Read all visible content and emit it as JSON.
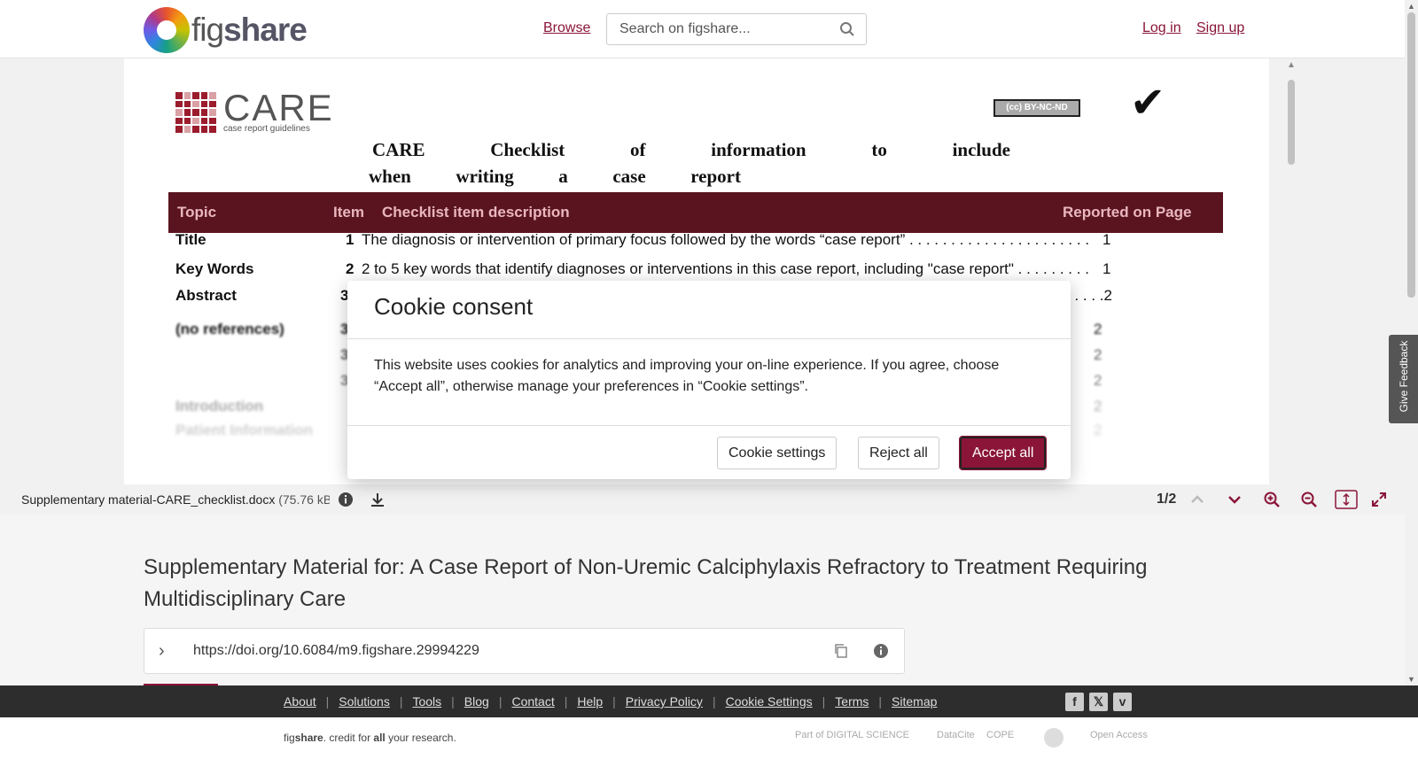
{
  "header": {
    "logo_text_light": "fig",
    "logo_text_bold": "share",
    "browse": "Browse",
    "search_placeholder": "Search on figshare...",
    "login": "Log in",
    "signup": "Sign up"
  },
  "document": {
    "care_title": "CARE",
    "care_subtitle": "case report guidelines",
    "license_badge": "BY-NC-ND",
    "heading_line1": [
      "CARE",
      "Checklist",
      "of",
      "information",
      "to",
      "include"
    ],
    "heading_line2": [
      "when",
      "writing",
      "a",
      "case",
      "report"
    ],
    "table_headers": [
      "Topic",
      "Item",
      "Checklist item description",
      "Reported on Page"
    ],
    "rows": [
      {
        "topic": "Title",
        "num": "1",
        "desc": "The diagnosis or intervention of primary focus followed by the words “case report” . . . . . . . . . . . . . . . . . . . . . .",
        "page": "1"
      },
      {
        "topic": "Key Words",
        "num": "2",
        "desc": "2 to 5 key words that identify diagnoses or interventions in this case report, including \"case report\"  . . . . . . . . .",
        "page": "1"
      },
      {
        "topic": "Abstract",
        "num": "3",
        "desc": "",
        "page": ". . . . .2"
      },
      {
        "topic": "(no references)",
        "num": "3",
        "desc": "",
        "page": "2"
      },
      {
        "topic": "",
        "num": "3",
        "desc": "",
        "page": "2"
      },
      {
        "topic": "",
        "num": "3",
        "desc": "",
        "page": "2"
      },
      {
        "topic": "Introduction",
        "num": "",
        "desc": "",
        "page": "2"
      },
      {
        "topic": "Patient Information",
        "num": "",
        "desc": "",
        "page": "2"
      }
    ]
  },
  "toolbar": {
    "filename": "Supplementary material-CARE_checklist.docx",
    "filesize": "(75.76 kB",
    "page_count": "1/2"
  },
  "item": {
    "title": "Supplementary Material for: A Case Report of Non-Uremic Calciphylaxis Refractory to Treatment Requiring Multidisciplinary Care",
    "doi": "https://doi.org/10.6084/m9.figshare.29994229"
  },
  "feedback": "Give Feedback",
  "footer": {
    "links": [
      "About",
      "Solutions",
      "Tools",
      "Blog",
      "Contact",
      "Help",
      "Privacy Policy",
      "Cookie Settings",
      "Terms",
      "Sitemap"
    ],
    "tagline_pre": "fig",
    "tagline_bold": "share",
    "tagline_mid": ". credit for ",
    "tagline_all": "all",
    "tagline_end": " your research.",
    "partners": [
      "Part of DIGITAL SCIENCE",
      "DataCite",
      "COPE",
      "Open Access"
    ]
  },
  "cookie_modal": {
    "title": "Cookie consent",
    "body": "This website uses cookies for analytics and improving your on-line experience. If you agree, choose “Accept all”, otherwise manage your preferences in “Cookie settings”.",
    "settings_label": "Cookie settings",
    "reject_label": "Reject all",
    "accept_label": "Accept all"
  },
  "colors": {
    "brand": "#8a1538",
    "table_header": "#5a1420",
    "footer_bg": "#2d2d2d"
  }
}
